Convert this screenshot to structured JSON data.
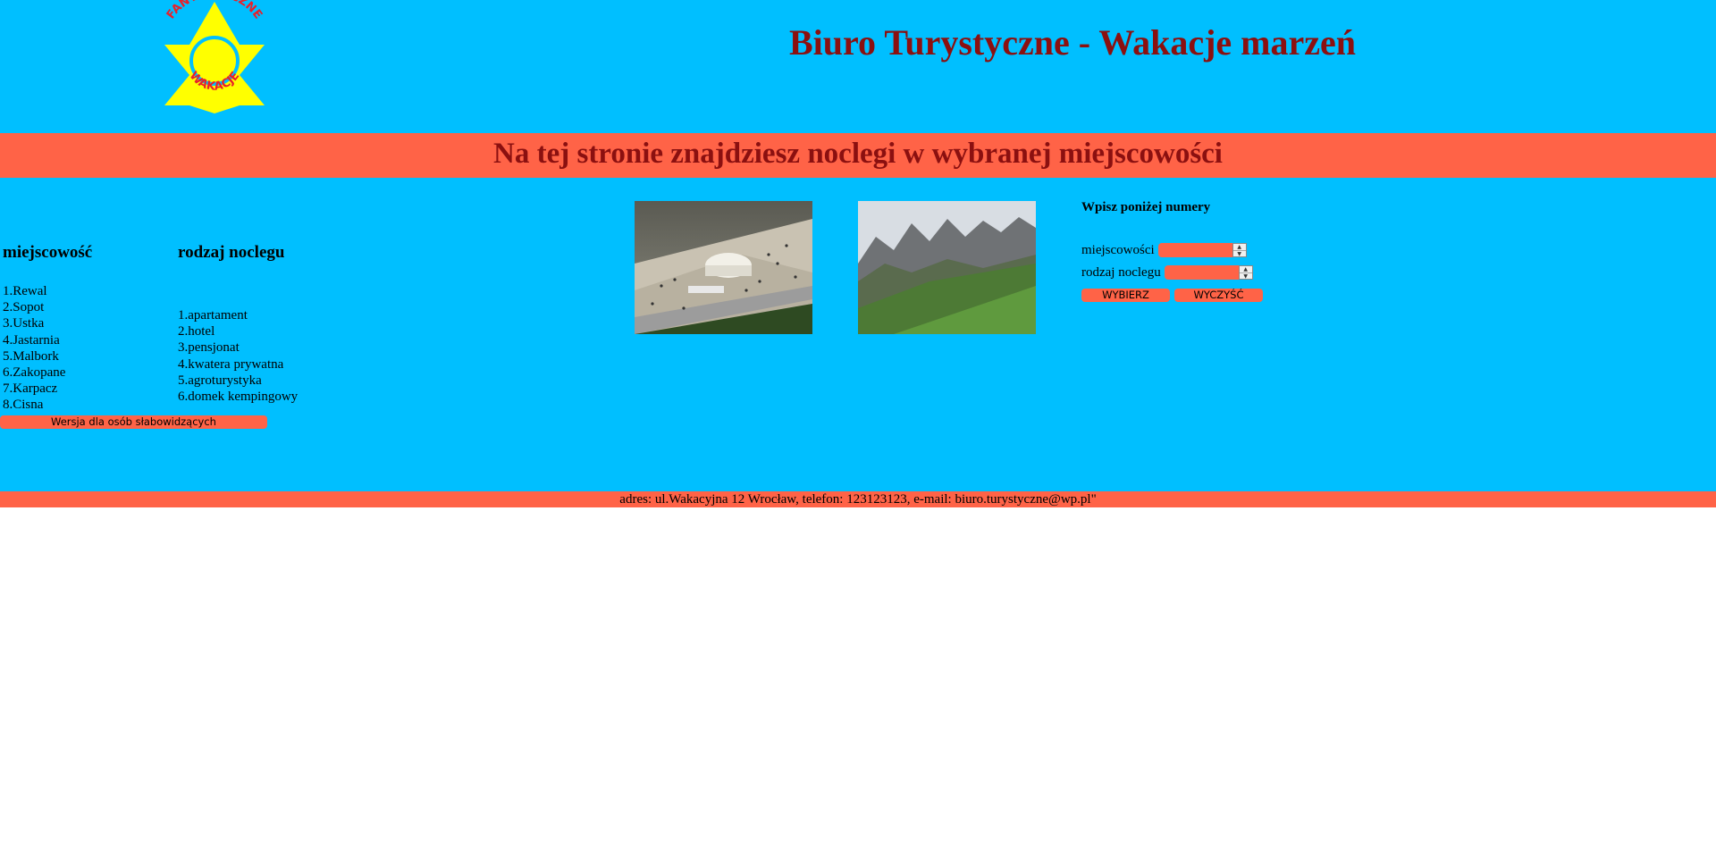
{
  "header": {
    "logo": {
      "top_text": "FANTASTYCZNE",
      "bottom_text": "WAKACJE",
      "colors": {
        "star": "#ffff00",
        "text": "#e8202a"
      }
    },
    "title": "Biuro Turystyczne - Wakacje marzeń"
  },
  "banner": {
    "title": "Na tej stronie znajdziesz noclegi w wybranej miejscowości"
  },
  "towns": {
    "heading": "miejscowość",
    "items": [
      "1.Rewal",
      "2.Sopot",
      "3.Ustka",
      "4.Jastarnia",
      "5.Malbork",
      "6.Zakopane",
      "7.Karpacz",
      "8.Cisna"
    ]
  },
  "lodging": {
    "heading": "rodzaj noclegu",
    "items": [
      "1.apartament",
      "2.hotel",
      "3.pensjonat",
      "4.kwatera prywatna",
      "5.agroturystyka",
      "6.domek kempingowy"
    ]
  },
  "accessibility_button": "Wersja dla osób słabowidzących",
  "images": [
    {
      "name": "beach-photo"
    },
    {
      "name": "mountains-photo"
    }
  ],
  "form": {
    "heading": "Wpisz poniżej numery",
    "town_label": "miejscowości",
    "town_value": "",
    "lodging_label": "rodzaj noclegu",
    "lodging_value": "",
    "select_button": "WYBIERZ",
    "clear_button": "WYCZYŚĆ"
  },
  "footer": {
    "text": "adres: ul.Wakacyjna 12 Wrocław, telefon: 123123123, e-mail: biuro.turystyczne@wp.pl\""
  },
  "colors": {
    "header_bg": "#00bfff",
    "banner_bg": "#ff6347",
    "title_text": "#8b1010",
    "button_bg": "#ff6347"
  }
}
